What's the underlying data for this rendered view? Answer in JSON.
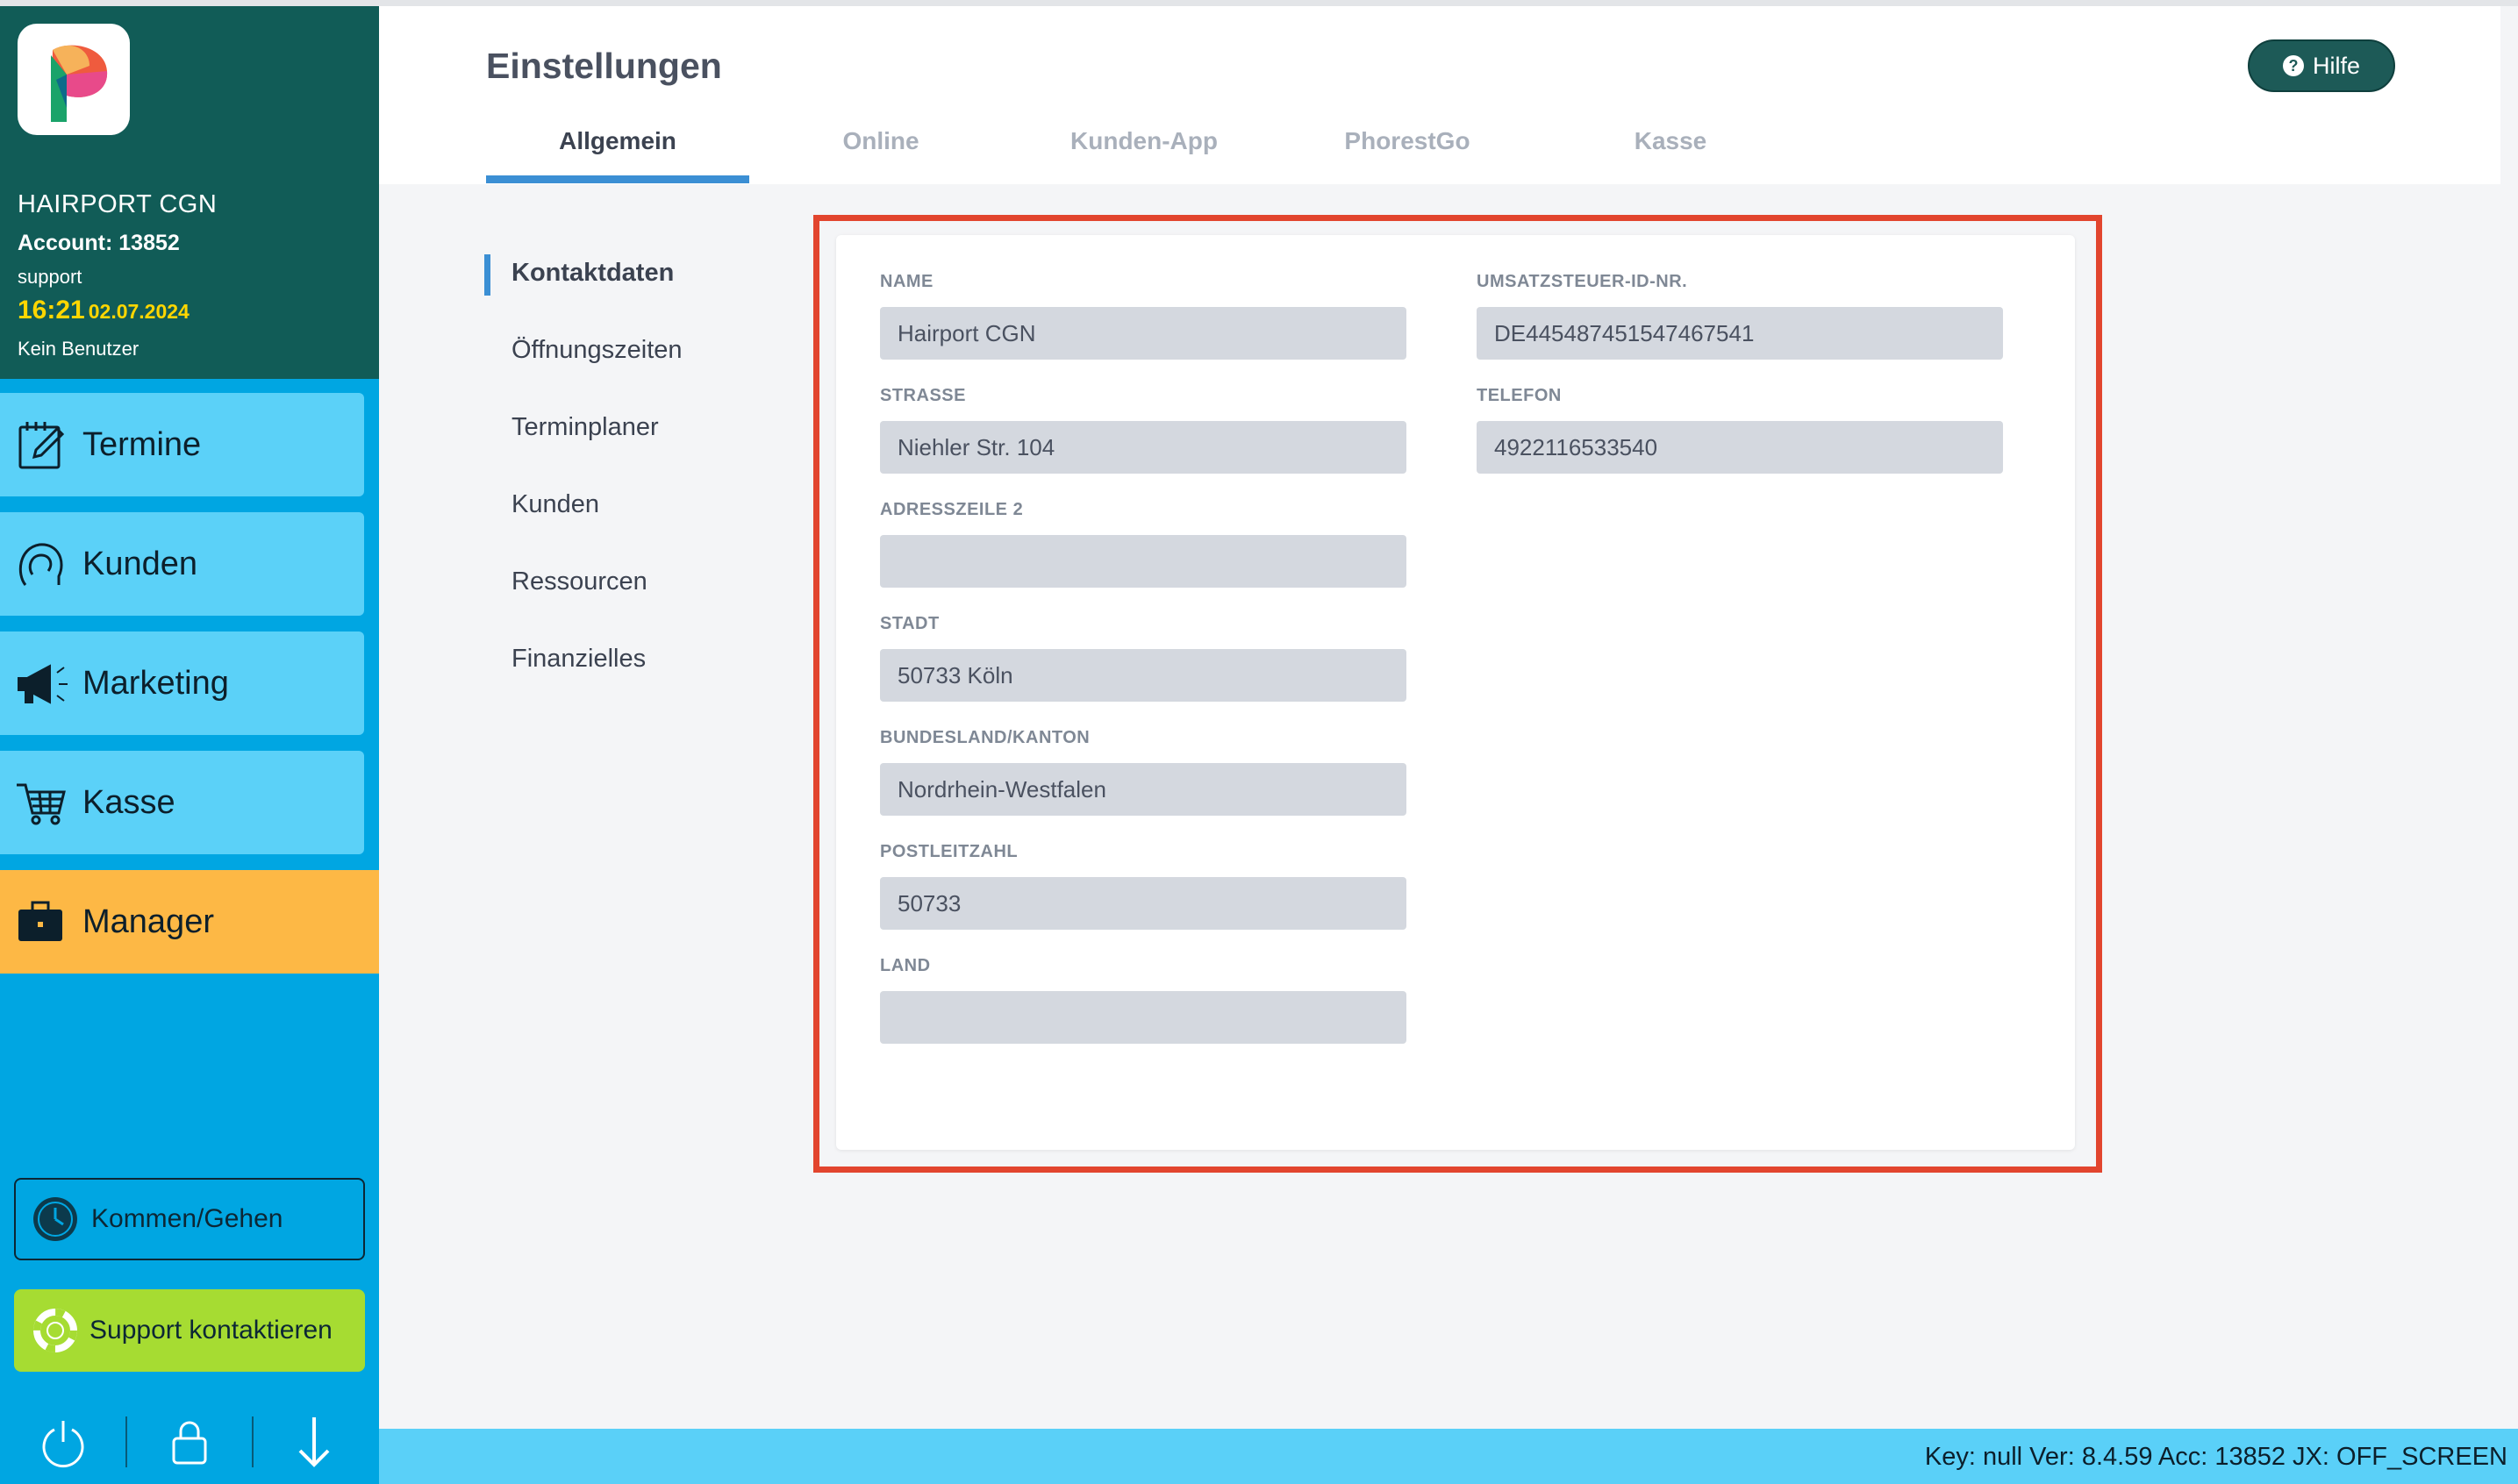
{
  "sidebar": {
    "salon_name": "HAIRPORT CGN",
    "account": "Account: 13852",
    "user": "support",
    "time": "16:21",
    "date": "02.07.2024",
    "current_user": "Kein Benutzer",
    "nav": [
      {
        "label": "Termine",
        "icon": "calendar-edit-icon"
      },
      {
        "label": "Kunden",
        "icon": "customer-head-icon"
      },
      {
        "label": "Marketing",
        "icon": "megaphone-icon"
      },
      {
        "label": "Kasse",
        "icon": "shopping-cart-icon"
      },
      {
        "label": "Manager",
        "icon": "briefcase-icon"
      }
    ],
    "clock_button": "Kommen/Gehen",
    "support_button": "Support kontaktieren",
    "colors": {
      "head": "#115c57",
      "nav": "#5bd1f8",
      "manager": "#fdb845",
      "body": "#00a6e2",
      "support": "#a6dc32"
    }
  },
  "header": {
    "title": "Einstellungen",
    "help": "Hilfe",
    "tabs": [
      "Allgemein",
      "Online",
      "Kunden-App",
      "PhorestGo",
      "Kasse"
    ],
    "active_tab": "Allgemein"
  },
  "subnav": {
    "items": [
      "Kontaktdaten",
      "Öffnungszeiten",
      "Terminplaner",
      "Kunden",
      "Ressourcen",
      "Finanzielles"
    ],
    "active": "Kontaktdaten"
  },
  "form": {
    "name": {
      "label": "NAME",
      "value": "Hairport CGN"
    },
    "vat": {
      "label": "UMSATZSTEUER-ID-NR.",
      "value": "DE445487451547467541"
    },
    "street": {
      "label": "STRASSE",
      "value": "Niehler Str. 104"
    },
    "phone": {
      "label": "TELEFON",
      "value": "4922116533540"
    },
    "address2": {
      "label": "ADRESSZEILE 2",
      "value": ""
    },
    "city": {
      "label": "STADT",
      "value": "50733 Köln"
    },
    "state": {
      "label": "BUNDESLAND/KANTON",
      "value": "Nordrhein-Westfalen"
    },
    "zip": {
      "label": "POSTLEITZAHL",
      "value": "50733"
    },
    "country": {
      "label": "LAND",
      "value": ""
    }
  },
  "status_bar": {
    "text": "Key: null Ver: 8.4.59 Acc: 13852  JX: OFF_SCREEN"
  }
}
